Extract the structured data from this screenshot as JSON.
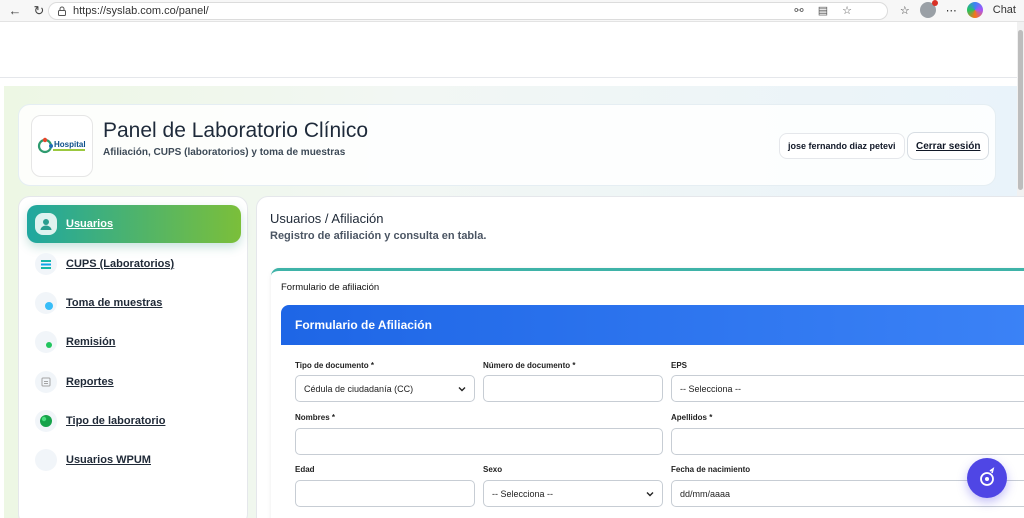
{
  "browser": {
    "url": "https://syslab.com.co/panel/",
    "chat_label": "Chat"
  },
  "header": {
    "logo_text": "Hospital",
    "title": "Panel de Laboratorio Clínico",
    "subtitle": "Afiliación, CUPS (laboratorios) y toma de muestras",
    "user_name": "jose fernando diaz petevi",
    "logout_label": "Cerrar sesión"
  },
  "sidebar": {
    "items": [
      {
        "label": "Usuarios",
        "icon": "user-icon"
      },
      {
        "label": "CUPS (Laboratorios)",
        "icon": "list-icon"
      },
      {
        "label": "Toma de muestras",
        "icon": "sample-icon"
      },
      {
        "label": "Remisión",
        "icon": "referral-icon"
      },
      {
        "label": "Reportes",
        "icon": "report-icon"
      },
      {
        "label": "Tipo de laboratorio",
        "icon": "lab-type-icon"
      },
      {
        "label": "Usuarios WPUM",
        "icon": "wpum-icon"
      }
    ]
  },
  "main": {
    "title": "Usuarios / Afiliación",
    "subtitle": "Registro de afiliación y consulta en tabla.",
    "form_card_title": "Formulario de afiliación",
    "form_header": "Formulario de Afiliación",
    "fields": {
      "tipo_documento": {
        "label": "Tipo de documento *",
        "value": "Cédula de ciudadanía (CC)"
      },
      "numero_documento": {
        "label": "Número de documento *",
        "value": ""
      },
      "eps": {
        "label": "EPS",
        "value": "-- Selecciona --"
      },
      "nombres": {
        "label": "Nombres *",
        "value": ""
      },
      "apellidos": {
        "label": "Apellidos *",
        "value": ""
      },
      "edad": {
        "label": "Edad",
        "value": ""
      },
      "sexo": {
        "label": "Sexo",
        "value": "-- Selecciona --"
      },
      "fecha_nacimiento": {
        "label": "Fecha de nacimiento",
        "value": "dd/mm/aaaa"
      }
    }
  },
  "colors": {
    "accent_start": "#1fa7a0",
    "accent_end": "#7bbf3a",
    "form_header_blue": "#1e66e6",
    "fab": "#4f46e5"
  }
}
